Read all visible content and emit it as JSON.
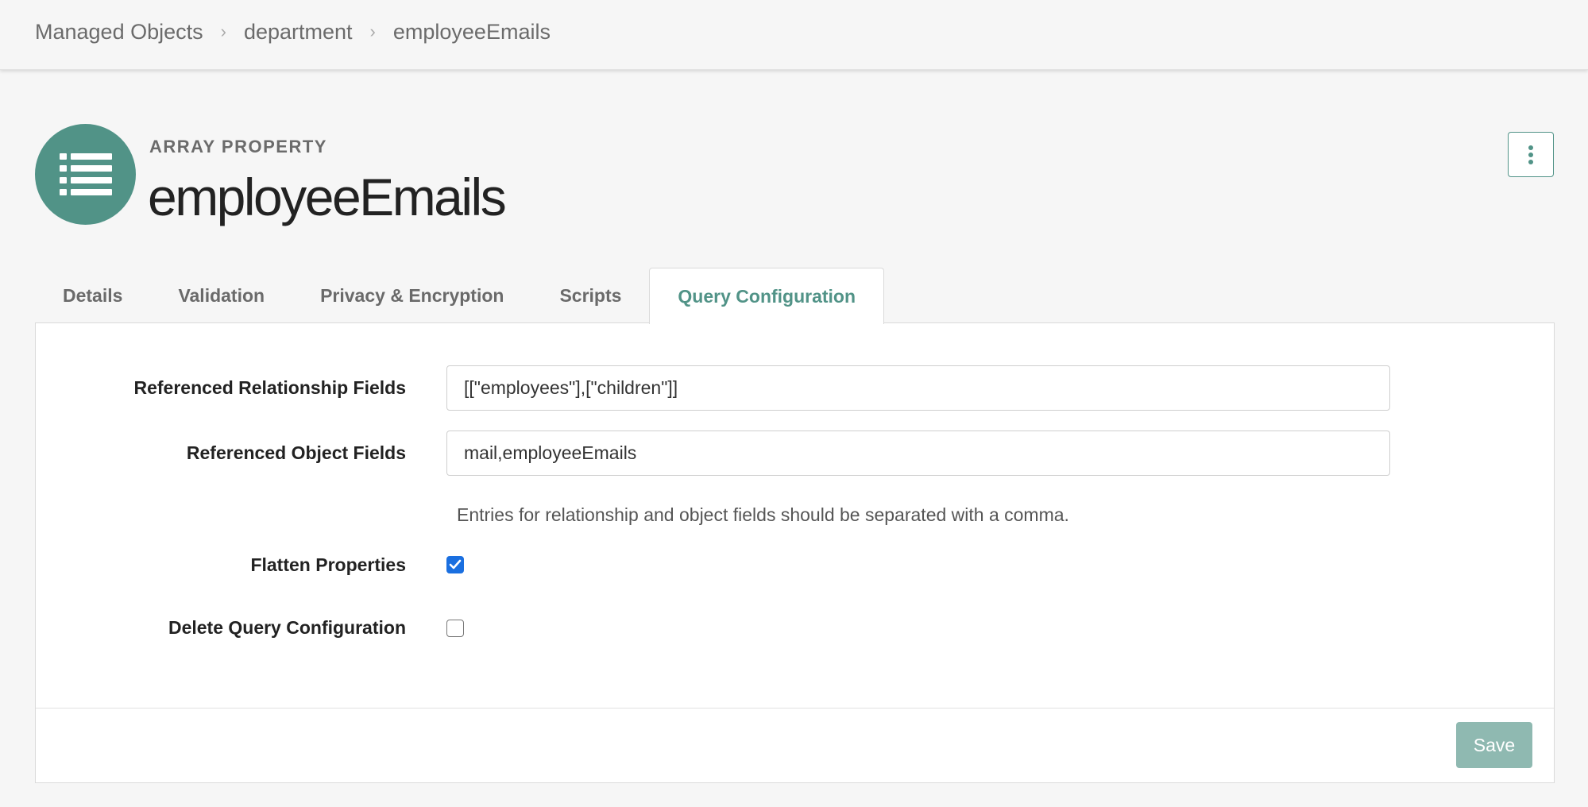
{
  "breadcrumb": [
    {
      "label": "Managed Objects"
    },
    {
      "label": "department"
    },
    {
      "label": "employeeEmails"
    }
  ],
  "header": {
    "type_label": "ARRAY PROPERTY",
    "title": "employeeEmails",
    "icon": "list-icon",
    "icon_color": "#519387"
  },
  "tabs": [
    {
      "label": "Details"
    },
    {
      "label": "Validation"
    },
    {
      "label": "Privacy & Encryption"
    },
    {
      "label": "Scripts"
    },
    {
      "label": "Query Configuration",
      "active": true
    }
  ],
  "form": {
    "referenced_relationship_fields": {
      "label": "Referenced Relationship Fields",
      "value": "[[\"employees\"],[\"children\"]]"
    },
    "referenced_object_fields": {
      "label": "Referenced Object Fields",
      "value": "mail,employeeEmails"
    },
    "help_text": "Entries for relationship and object fields should be separated with a comma.",
    "flatten_properties": {
      "label": "Flatten Properties",
      "checked": true
    },
    "delete_query_configuration": {
      "label": "Delete Query Configuration",
      "checked": false
    }
  },
  "footer": {
    "save_label": "Save"
  },
  "colors": {
    "accent": "#519387",
    "checkbox": "#1a6fe0",
    "save_disabled": "#8fb9b1"
  }
}
